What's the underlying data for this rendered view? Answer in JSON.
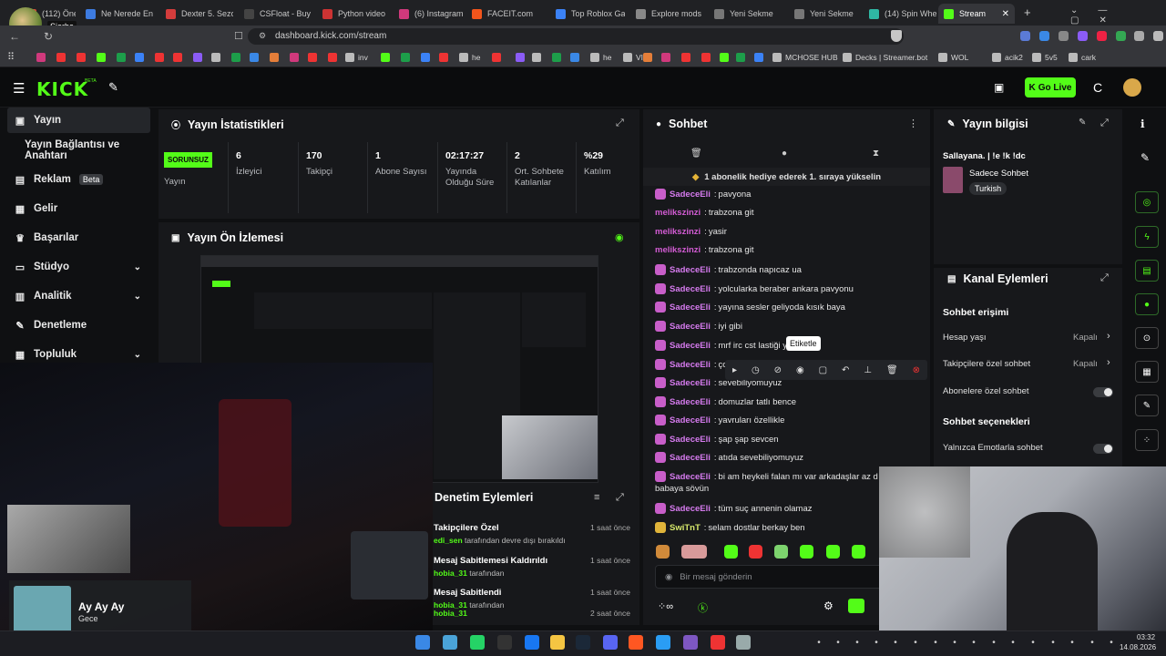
{
  "browser": {
    "tabs": [
      {
        "label": "(112) Öneri",
        "color": "#e4443a"
      },
      {
        "label": "Ne Nerede En",
        "color": "#3d7be0"
      },
      {
        "label": "Dexter 5. Sezo",
        "color": "#d33c3c"
      },
      {
        "label": "CSFloat - Buy",
        "color": "#444"
      },
      {
        "label": "Python video",
        "color": "#c33"
      },
      {
        "label": "(6) Instagram",
        "color": "#d0397c"
      },
      {
        "label": "FACEIT.com",
        "color": "#f2551c"
      },
      {
        "label": "Top Roblox Ga",
        "color": "#3b82f6"
      },
      {
        "label": "Explore mods",
        "color": "#888"
      },
      {
        "label": "Yeni Sekme",
        "color": "#777"
      },
      {
        "label": "Yeni Sekme",
        "color": "#777"
      },
      {
        "label": "(14) Spin Whe",
        "color": "#2fb8a4"
      },
      {
        "label": "Stream",
        "color": "#53fc18"
      }
    ],
    "profile_tooltip": "Sierba",
    "url": "dashboard.kick.com/stream",
    "bookmarks": [
      "inv",
      "he",
      "he",
      "VIA",
      "MCHOSE HUB",
      "Decks | Streamer.bot",
      "WOL",
      "acik2",
      "5v5",
      "cark"
    ]
  },
  "header": {
    "logo": "KICK",
    "beta": "BETA",
    "go_live": "Go Live"
  },
  "sidebar": {
    "items": [
      {
        "label": "Yayın",
        "icon": "camera-icon"
      },
      {
        "label": "Yayın Bağlantısı ve Anahtarı"
      },
      {
        "label": "Reklam",
        "badge": "Beta",
        "icon": "ads-icon"
      },
      {
        "label": "Gelir",
        "icon": "revenue-icon"
      },
      {
        "label": "Başarılar",
        "icon": "trophy-icon"
      },
      {
        "label": "Stüdyo",
        "icon": "studio-icon"
      },
      {
        "label": "Analitik",
        "icon": "analytics-icon"
      },
      {
        "label": "Denetleme",
        "icon": "moderation-icon"
      },
      {
        "label": "Topluluk",
        "icon": "community-icon"
      }
    ]
  },
  "stats": {
    "title": "Yayın İstatistikleri",
    "status_badge": "SORUNSUZ",
    "status_label": "Yayın",
    "cells": [
      {
        "value": "6",
        "label": "İzleyici"
      },
      {
        "value": "170",
        "label": "Takipçi"
      },
      {
        "value": "1",
        "label": "Abone Sayısı"
      },
      {
        "value": "02:17:27",
        "label": "Yayında Olduğu Süre"
      },
      {
        "value": "2",
        "label": "Ort. Sohbete Katılanlar"
      },
      {
        "value": "%29",
        "label": "Katılım"
      }
    ]
  },
  "preview": {
    "title": "Yayın Ön İzlemesi"
  },
  "moderation": {
    "title": "Denetim Eylemleri",
    "items": [
      {
        "title": "Takipçilere Özel",
        "by": "edi_sen",
        "suffix": " tarafından devre dışı bırakıldı",
        "time": "1 saat önce"
      },
      {
        "title": "Mesaj Sabitlemesi Kaldırıldı",
        "by": "hobia_31",
        "suffix": " tarafından",
        "time": "1 saat önce"
      },
      {
        "title": "Mesaj Sabitlendi",
        "by": "hobia_31",
        "suffix": " tarafından",
        "time": "1 saat önce"
      },
      {
        "title": "",
        "by": "hobia_31",
        "suffix": "",
        "time": "2 saat önce"
      }
    ]
  },
  "music": {
    "title": "Ay Ay Ay",
    "artist": "Gece"
  },
  "chat": {
    "title": "Sohbet",
    "banner": "1 abonelik hediye ederek 1. sıraya yükselin",
    "input_placeholder": "Bir mesaj gönderin",
    "tooltip": "Etiketle",
    "messages": [
      {
        "user": "SadeceEli",
        "text": "pavyona",
        "badge": true
      },
      {
        "user": "melikszinzi",
        "text": "trabzona git",
        "badge": false
      },
      {
        "user": "melikszinzi",
        "text": "yasir",
        "badge": false
      },
      {
        "user": "melikszinzi",
        "text": "trabzona git",
        "badge": false
      },
      {
        "user": "SadeceEli",
        "text": "trabzonda napıcaz ua",
        "badge": true
      },
      {
        "user": "SadeceEli",
        "text": "yolcularka beraber ankara pavyonu",
        "badge": true
      },
      {
        "user": "SadeceEli",
        "text": "yayına sesler geliyoda kısık baya",
        "badge": true
      },
      {
        "user": "SadeceEli",
        "text": "iyi gibi",
        "badge": true
      },
      {
        "user": "SadeceEli",
        "text": "mrf irc cst lastiği y",
        "badge": true
      },
      {
        "user": "SadeceEli",
        "text": "çok",
        "badge": true
      },
      {
        "user": "SadeceEli",
        "text": "sevebiliyomuyuz",
        "badge": true
      },
      {
        "user": "SadeceEli",
        "text": "domuzlar tatlı bence",
        "badge": true
      },
      {
        "user": "SadeceEli",
        "text": "yavruları özellikle",
        "badge": true
      },
      {
        "user": "SadeceEli",
        "text": "şap şap sevcen",
        "badge": true
      },
      {
        "user": "SadeceEli",
        "text": "atıda sevebiliyomuyuz",
        "badge": true
      },
      {
        "user": "SadeceEli",
        "text": "bi am heykeli falan mı var arkadaşlar az d",
        "badge": true,
        "cont": "babaya sövün"
      },
      {
        "user": "SadeceEli",
        "text": "tüm suç annenin olamaz",
        "badge": true
      },
      {
        "user": "SwiTnT",
        "text": "selam dostlar berkay ben",
        "badge": "gold"
      }
    ]
  },
  "stream_info": {
    "title": "Yayın bilgisi",
    "stream_title": "Sallayana. | !e !k !dc",
    "category": "Sadece Sohbet",
    "tag": "Turkish"
  },
  "channel_actions": {
    "title": "Kanal Eylemleri",
    "chat_access_title": "Sohbet erişimi",
    "rows": [
      {
        "label": "Hesap yaşı",
        "value": "Kapalı"
      },
      {
        "label": "Takipçilere özel sohbet",
        "value": "Kapalı"
      },
      {
        "label": "Abonelere özel sohbet",
        "value": ""
      }
    ],
    "options_title": "Sohbet seçenekleri",
    "options": [
      {
        "label": "Yalnızca Emotlarla sohbet"
      }
    ]
  },
  "taskbar": {
    "time": "03:32",
    "date": "14.08.2026"
  }
}
